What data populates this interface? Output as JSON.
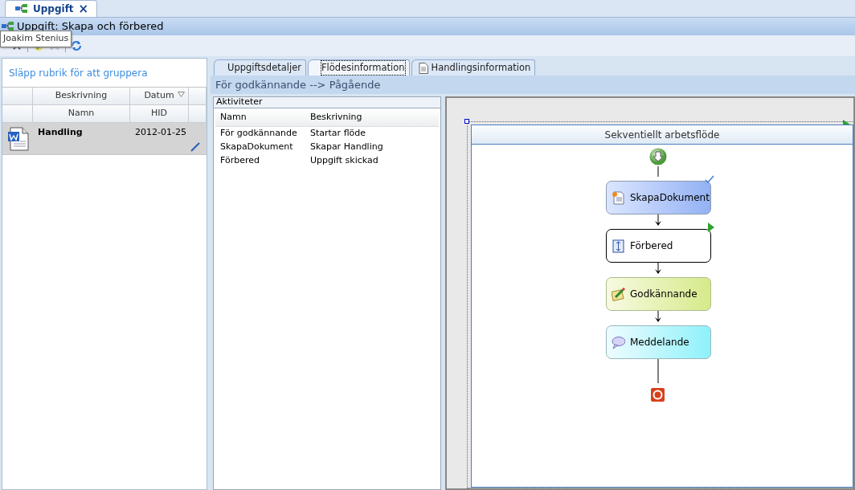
{
  "document_tab": {
    "label": "Uppgift",
    "close": "×",
    "selected": true
  },
  "title": "Uppgift: Skapa och förbered",
  "tooltip": "Joakim Stenius",
  "toolbar": [
    {
      "kind": "close",
      "disabled": false
    },
    {
      "kind": "approve",
      "disabled": false
    },
    {
      "kind": "delete",
      "disabled": true
    },
    {
      "kind": "refresh",
      "disabled": false
    }
  ],
  "grid": {
    "group_hint": "Släpp rubrik för att gruppera",
    "header_rows": [
      [
        "Beskrivning",
        "Datum"
      ],
      [
        "Namn",
        "HID"
      ]
    ],
    "rows": [
      {
        "name": "Handling",
        "date": "2012-01-25",
        "selected": true
      }
    ]
  },
  "tabs": [
    {
      "label": "Uppgiftsdetaljer",
      "selected": false,
      "icon": false
    },
    {
      "label": "Flödesinformation",
      "selected": true,
      "icon": false
    },
    {
      "label": "Handlingsinformation",
      "selected": false,
      "icon": true
    }
  ],
  "status": "För godkännande --> Pågående",
  "activities": {
    "title": "Aktiviteter",
    "columns": [
      "Namn",
      "Beskrivning"
    ],
    "rows": [
      [
        "För godkännande",
        "Startar flöde"
      ],
      [
        "SkapaDokument",
        "Skapar Handling"
      ],
      [
        "Förbered",
        "Uppgift skickad"
      ]
    ]
  },
  "workflow": {
    "title": "Sekventiellt arbetsflöde",
    "steps": [
      {
        "label": "SkapaDokument",
        "kind": "document",
        "completed": true,
        "current": false
      },
      {
        "label": "Förbered",
        "kind": "sequence",
        "completed": false,
        "current": true
      },
      {
        "label": "Godkännande",
        "kind": "approval",
        "completed": false,
        "current": false
      },
      {
        "label": "Meddelande",
        "kind": "message",
        "completed": false,
        "current": false
      }
    ]
  }
}
